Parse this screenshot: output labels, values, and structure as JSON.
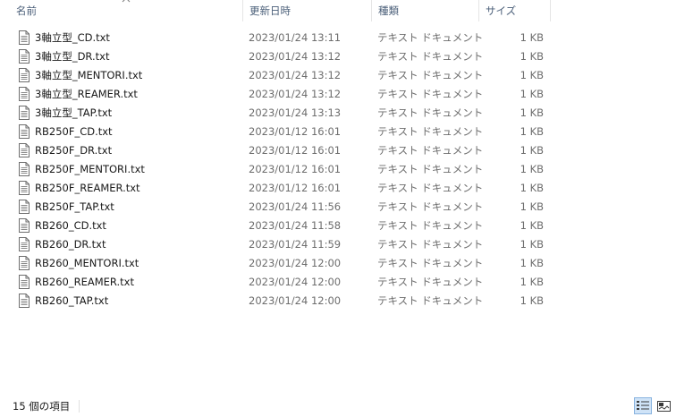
{
  "columns": {
    "name": "名前",
    "date": "更新日時",
    "type": "種類",
    "size": "サイズ"
  },
  "files": [
    {
      "name": "3軸立型_CD.txt",
      "date": "2023/01/24 13:11",
      "type": "テキスト ドキュメント",
      "size": "1 KB"
    },
    {
      "name": "3軸立型_DR.txt",
      "date": "2023/01/24 13:12",
      "type": "テキスト ドキュメント",
      "size": "1 KB"
    },
    {
      "name": "3軸立型_MENTORI.txt",
      "date": "2023/01/24 13:12",
      "type": "テキスト ドキュメント",
      "size": "1 KB"
    },
    {
      "name": "3軸立型_REAMER.txt",
      "date": "2023/01/24 13:12",
      "type": "テキスト ドキュメント",
      "size": "1 KB"
    },
    {
      "name": "3軸立型_TAP.txt",
      "date": "2023/01/24 13:13",
      "type": "テキスト ドキュメント",
      "size": "1 KB"
    },
    {
      "name": "RB250F_CD.txt",
      "date": "2023/01/12 16:01",
      "type": "テキスト ドキュメント",
      "size": "1 KB"
    },
    {
      "name": "RB250F_DR.txt",
      "date": "2023/01/12 16:01",
      "type": "テキスト ドキュメント",
      "size": "1 KB"
    },
    {
      "name": "RB250F_MENTORI.txt",
      "date": "2023/01/12 16:01",
      "type": "テキスト ドキュメント",
      "size": "1 KB"
    },
    {
      "name": "RB250F_REAMER.txt",
      "date": "2023/01/12 16:01",
      "type": "テキスト ドキュメント",
      "size": "1 KB"
    },
    {
      "name": "RB250F_TAP.txt",
      "date": "2023/01/24 11:56",
      "type": "テキスト ドキュメント",
      "size": "1 KB"
    },
    {
      "name": "RB260_CD.txt",
      "date": "2023/01/24 11:58",
      "type": "テキスト ドキュメント",
      "size": "1 KB"
    },
    {
      "name": "RB260_DR.txt",
      "date": "2023/01/24 11:59",
      "type": "テキスト ドキュメント",
      "size": "1 KB"
    },
    {
      "name": "RB260_MENTORI.txt",
      "date": "2023/01/24 12:00",
      "type": "テキスト ドキュメント",
      "size": "1 KB"
    },
    {
      "name": "RB260_REAMER.txt",
      "date": "2023/01/24 12:00",
      "type": "テキスト ドキュメント",
      "size": "1 KB"
    },
    {
      "name": "RB260_TAP.txt",
      "date": "2023/01/24 12:00",
      "type": "テキスト ドキュメント",
      "size": "1 KB"
    }
  ],
  "status": {
    "item_count": "15 個の項目"
  },
  "icons": {
    "sort": "sort-ascending-icon",
    "file": "text-file-icon",
    "details_view": "details-view-icon",
    "tiles_view": "large-icons-view-icon"
  },
  "colors": {
    "header_text": "#4c607a",
    "selected_view_bg": "#cfe3f7",
    "selected_view_border": "#8ab4e0"
  }
}
